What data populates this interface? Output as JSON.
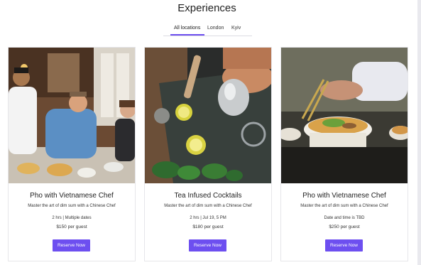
{
  "page": {
    "title": "Experiences"
  },
  "tabs": [
    {
      "label": "All locations",
      "active": true
    },
    {
      "label": "London",
      "active": false
    },
    {
      "label": "Kyiv",
      "active": false
    }
  ],
  "accent_color": "#6d4ff0",
  "cards": [
    {
      "image": "restaurant-chefs-dining-photo",
      "title": "Pho with Vietnamese Chef",
      "subtitle": "Master the art of dim sum with a Chinese Chef",
      "meta": "2 hrs | Multiple dates",
      "price": "$150 per guest",
      "button": "Reserve Now"
    },
    {
      "image": "cocktail-shaker-photo",
      "title": "Tea Infused Cocktails",
      "subtitle": "Master the art of dim sum with a Chinese Chef",
      "meta": "2 hrs | Jul 19, 5 PM",
      "price": "$180 per guest",
      "button": "Reserve Now"
    },
    {
      "image": "pho-noodle-bowl-photo",
      "title": "Pho with Vietnamese Chef",
      "subtitle": "Master the art of dim sum with a Chinese Chef",
      "meta": "Date and time is TBD",
      "price": "$250 per guest",
      "button": "Reserve Now"
    }
  ]
}
